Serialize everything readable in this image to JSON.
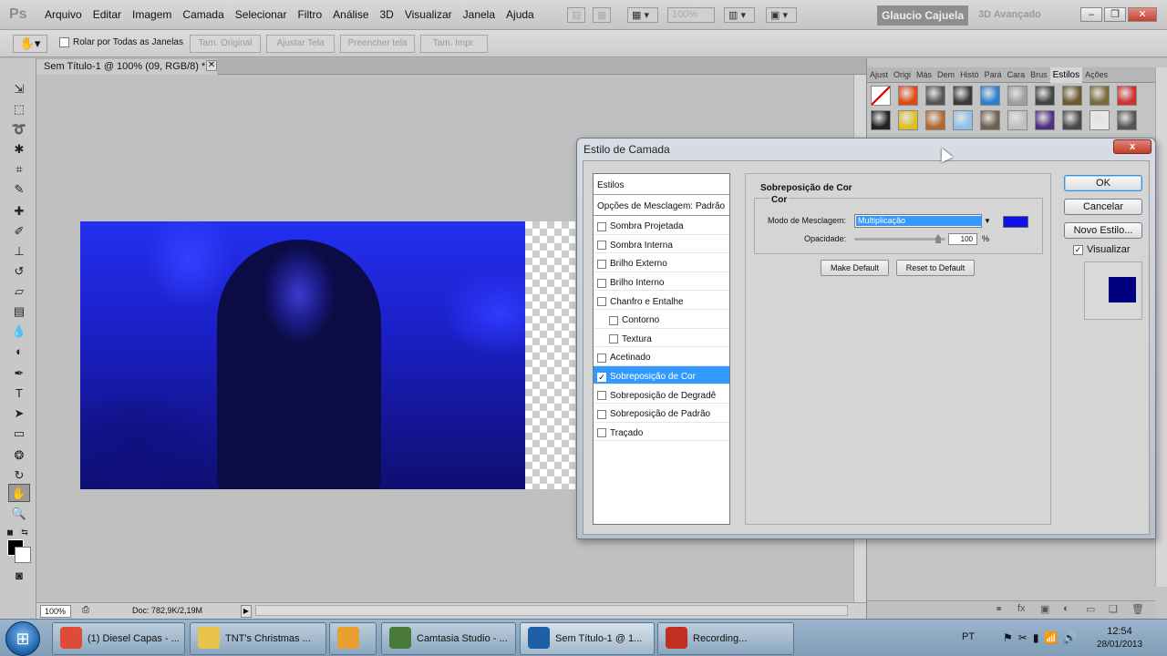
{
  "menubar": {
    "logo": "Ps",
    "items": [
      "Arquivo",
      "Editar",
      "Imagem",
      "Camada",
      "Selecionar",
      "Filtro",
      "Análise",
      "3D",
      "Visualizar",
      "Janela",
      "Ajuda"
    ],
    "zoom": "100%",
    "workspace_active": "Glaucio Cajuela",
    "workspace_other": "3D Avançado"
  },
  "optionsbar": {
    "scroll_all_label": "Rolar por Todas as Janelas",
    "btn_actual": "Tam. Original",
    "btn_fit": "Ajustar Tela",
    "btn_fill": "Preencher tela",
    "btn_print": "Tam. Impr."
  },
  "document": {
    "tab_title": "Sem Título-1 @ 100% (09, RGB/8) *",
    "zoom": "100%",
    "info": "Doc: 782,9K/2,19M"
  },
  "panels": {
    "tabs": [
      "Ajust",
      "Origi",
      "Más",
      "Dem",
      "Histó",
      "Pará",
      "Cara",
      "Brus",
      "Estilos",
      "Ações"
    ],
    "active_tab": "Estilos",
    "swatches": [
      "#ffffff",
      "#e04a10",
      "#555555",
      "#3a3a3a",
      "#2a7fd0",
      "#a0a0a0",
      "#444444",
      "#6b5a2a",
      "#7a6a3a",
      "#d03030",
      "#222222",
      "#e0c020",
      "#b06a30",
      "#90c0e8",
      "#706050",
      "#c0c0c0",
      "#503080",
      "#4a4a4a",
      "#e8e8e8",
      "#555555"
    ]
  },
  "dialog": {
    "title": "Estilo de Camada",
    "close": "x",
    "styles_header": "Estilos",
    "blend_options": "Opções de Mesclagem: Padrão",
    "styles": [
      {
        "label": "Sombra Projetada",
        "checked": false,
        "indent": false,
        "selected": false
      },
      {
        "label": "Sombra Interna",
        "checked": false,
        "indent": false,
        "selected": false
      },
      {
        "label": "Brilho Externo",
        "checked": false,
        "indent": false,
        "selected": false
      },
      {
        "label": "Brilho Interno",
        "checked": false,
        "indent": false,
        "selected": false
      },
      {
        "label": "Chanfro e Entalhe",
        "checked": false,
        "indent": false,
        "selected": false
      },
      {
        "label": "Contorno",
        "checked": false,
        "indent": true,
        "selected": false
      },
      {
        "label": "Textura",
        "checked": false,
        "indent": true,
        "selected": false
      },
      {
        "label": "Acetinado",
        "checked": false,
        "indent": false,
        "selected": false
      },
      {
        "label": "Sobreposição de Cor",
        "checked": true,
        "indent": false,
        "selected": true
      },
      {
        "label": "Sobreposição de Degradê",
        "checked": false,
        "indent": false,
        "selected": false
      },
      {
        "label": "Sobreposição de Padrão",
        "checked": false,
        "indent": false,
        "selected": false
      },
      {
        "label": "Traçado",
        "checked": false,
        "indent": false,
        "selected": false
      }
    ],
    "section_title": "Sobreposição de Cor",
    "subsection_title": "Cor",
    "blend_mode_label": "Modo de Mesclagem:",
    "blend_mode_value": "Multiplicação",
    "overlay_color": "#0f12e6",
    "opacity_label": "Opacidade:",
    "opacity_value": "100",
    "opacity_unit": "%",
    "make_default": "Make Default",
    "reset_default": "Reset to Default",
    "ok": "OK",
    "cancel": "Cancelar",
    "new_style": "Novo Estilo...",
    "preview_label": "Visualizar",
    "preview_checked": true,
    "preview_color": "#000080"
  },
  "taskbar": {
    "items": [
      {
        "label": "(1) Diesel Capas - ...",
        "icon_color": "#dd4b39"
      },
      {
        "label": "TNT's Christmas ...",
        "icon_color": "#e8c44a"
      },
      {
        "label": "",
        "icon_color": "#e8a030"
      },
      {
        "label": "Camtasia Studio - ...",
        "icon_color": "#4a7a3a"
      },
      {
        "label": "Sem Título-1 @ 1...",
        "icon_color": "#1d5fa8"
      },
      {
        "label": "Recording...",
        "icon_color": "#c03020"
      }
    ],
    "lang": "PT",
    "time": "12:54",
    "date": "28/01/2013"
  }
}
